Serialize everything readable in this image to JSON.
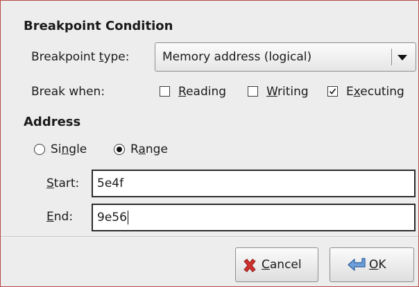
{
  "breakpoint_condition": {
    "title": "Breakpoint Condition",
    "type_label_pre": "Breakpoint ",
    "type_label_mnemonic": "t",
    "type_label_post": "ype:",
    "type_value": "Memory address (logical)",
    "break_when_label": "Break when:",
    "options": [
      {
        "mnemonic": "R",
        "rest": "eading",
        "checked": false
      },
      {
        "mnemonic": "W",
        "rest": "riting",
        "checked": false
      },
      {
        "pre": "E",
        "mnemonic": "x",
        "rest": "ecuting",
        "checked": true
      }
    ]
  },
  "address": {
    "title": "Address",
    "single_pre": "Si",
    "single_mnemonic": "n",
    "single_post": "gle",
    "range_pre": "R",
    "range_mnemonic": "a",
    "range_post": "nge",
    "selected": "Range",
    "start_mnemonic": "S",
    "start_rest": "tart:",
    "start_value": "5e4f",
    "end_mnemonic": "E",
    "end_rest": "nd:",
    "end_value": "9e56"
  },
  "buttons": {
    "cancel_mnemonic": "C",
    "cancel_rest": "ancel",
    "ok_mnemonic": "O",
    "ok_rest": "K"
  },
  "colors": {
    "window_bg": "#ededed",
    "frame_border": "#b94a48",
    "cancel_icon": "#d0312d",
    "ok_icon": "#4a7fc1"
  },
  "icons": {
    "dropdown": "triangle-down",
    "check": "checkmark",
    "cancel": "red-x",
    "ok": "blue-return-arrow"
  }
}
